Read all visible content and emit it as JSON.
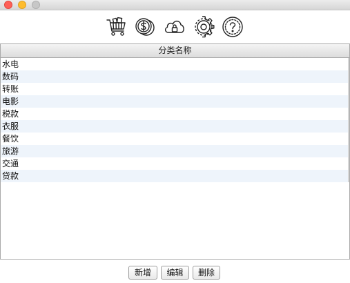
{
  "window": {
    "traffic_lights": [
      {
        "name": "close",
        "color": "#fe5f57"
      },
      {
        "name": "minimize",
        "color": "#febc2e"
      },
      {
        "name": "maximize",
        "color": "#c7c7c7"
      }
    ]
  },
  "toolbar": {
    "icons": [
      "cart-icon",
      "coin-icon",
      "cloud-lock-icon",
      "gear-icon",
      "help-icon"
    ]
  },
  "table": {
    "column_header": "分类名称",
    "rows": [
      "水电",
      "数码",
      "转账",
      "电影",
      "税款",
      "衣服",
      "餐饮",
      "旅游",
      "交通",
      "贷款"
    ]
  },
  "buttons": {
    "add_label": "新增",
    "edit_label": "编辑",
    "delete_label": "删除"
  },
  "colors": {
    "row_alt": "#eef4fb",
    "border": "#a9a9a9"
  }
}
